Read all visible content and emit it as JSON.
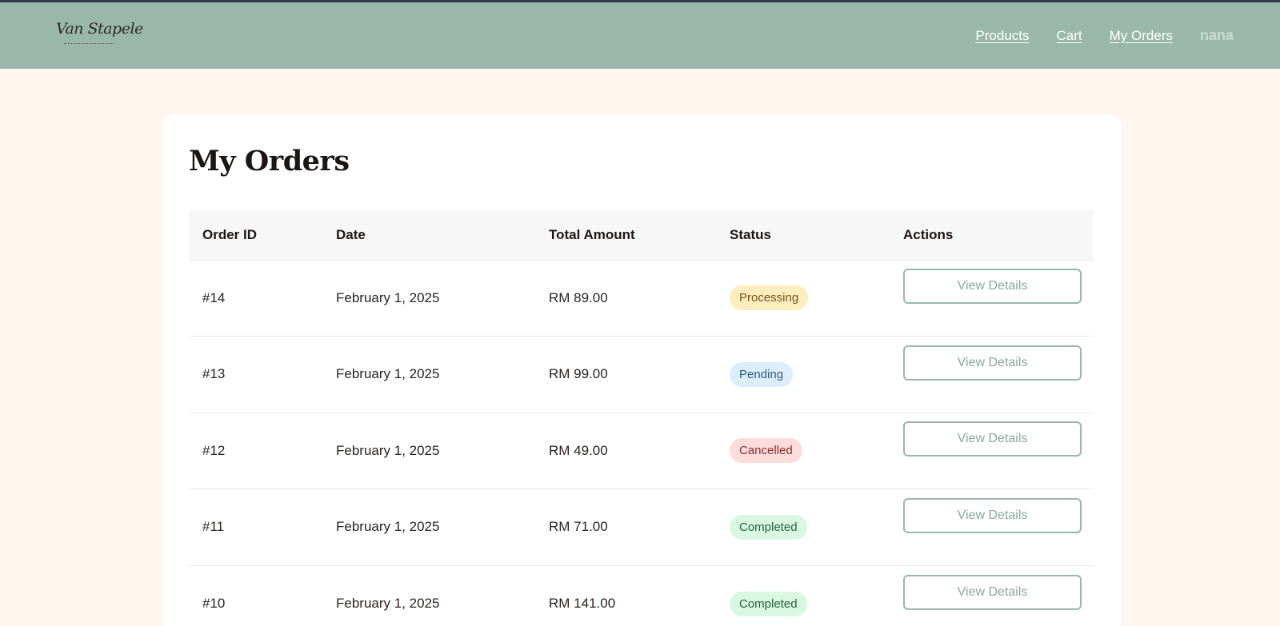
{
  "header": {
    "logo_text": "Van Stapele",
    "logo_subtext": "COLLECTIBLES",
    "nav": [
      {
        "label": "Products"
      },
      {
        "label": "Cart"
      },
      {
        "label": "My Orders"
      }
    ],
    "username": "nana"
  },
  "colors": {
    "header_bg": "#99b8ab",
    "page_bg": "#fff6f0",
    "accent": "#99b8ab"
  },
  "main": {
    "title": "My Orders",
    "table": {
      "columns": [
        "Order ID",
        "Date",
        "Total Amount",
        "Status",
        "Actions"
      ],
      "rows": [
        {
          "id": "#14",
          "date": "February 1, 2025",
          "total": "RM 89.00",
          "status": "Processing",
          "status_kind": "processing",
          "action": "View Details"
        },
        {
          "id": "#13",
          "date": "February 1, 2025",
          "total": "RM 99.00",
          "status": "Pending",
          "status_kind": "pending",
          "action": "View Details"
        },
        {
          "id": "#12",
          "date": "February 1, 2025",
          "total": "RM 49.00",
          "status": "Cancelled",
          "status_kind": "cancelled",
          "action": "View Details"
        },
        {
          "id": "#11",
          "date": "February 1, 2025",
          "total": "RM 71.00",
          "status": "Completed",
          "status_kind": "completed",
          "action": "View Details"
        },
        {
          "id": "#10",
          "date": "February 1, 2025",
          "total": "RM 141.00",
          "status": "Completed",
          "status_kind": "completed",
          "action": "View Details"
        }
      ]
    }
  }
}
